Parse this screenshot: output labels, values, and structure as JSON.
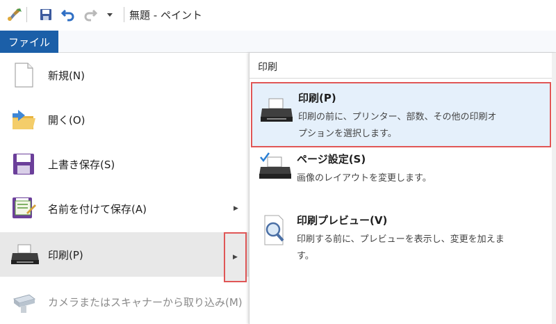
{
  "titlebar": {
    "title": "無題 - ペイント"
  },
  "menubar": {
    "file_tab": "ファイル"
  },
  "left_menu": {
    "items": [
      {
        "label": "新規(N)",
        "icon": "new-file-icon"
      },
      {
        "label": "開く(O)",
        "icon": "open-folder-icon"
      },
      {
        "label": "上書き保存(S)",
        "icon": "save-icon"
      },
      {
        "label": "名前を付けて保存(A)",
        "icon": "save-as-icon"
      },
      {
        "label": "印刷(P)",
        "icon": "printer-icon"
      },
      {
        "label": "カメラまたはスキャナーから取り込み(M)",
        "icon": "scanner-icon"
      }
    ]
  },
  "print_panel": {
    "heading": "印刷",
    "items": [
      {
        "title": "印刷(P)",
        "desc1": "印刷の前に、プリンター、部数、その他の印刷オ",
        "desc2": "プションを選択します。"
      },
      {
        "title": "ページ設定(S)",
        "desc1": "画像のレイアウトを変更します。",
        "desc2": ""
      },
      {
        "title": "印刷プレビュー(V)",
        "desc1": "印刷する前に、プレビューを表示し、変更を加えま",
        "desc2": "す。"
      }
    ]
  },
  "colors": {
    "file_tab": "#1b5fa8",
    "highlight_border": "#e05656",
    "highlight_bg": "#e5f0fb"
  }
}
